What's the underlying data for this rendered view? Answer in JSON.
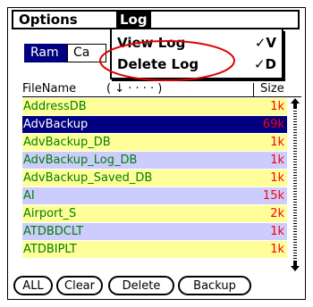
{
  "menubar": {
    "options_label": "Options",
    "log_label": "Log"
  },
  "log_menu": {
    "items": [
      {
        "label": "View Log",
        "shortcut": "✓V"
      },
      {
        "label": "Delete Log",
        "shortcut": "✓D"
      }
    ]
  },
  "toolbar": {
    "ram_label": "Ram",
    "card_label": "Ca"
  },
  "columns": {
    "filename": "FileName",
    "sort_hint": "( ↓ · · · · )",
    "size": "Size"
  },
  "files": [
    {
      "name": "AddressDB",
      "size": "1k",
      "style": "yellow"
    },
    {
      "name": "AdvBackup",
      "size": "69k",
      "style": "selected"
    },
    {
      "name": "AdvBackup_DB",
      "size": "1k",
      "style": "yellow"
    },
    {
      "name": "AdvBackup_Log_DB",
      "size": "1k",
      "style": "lav"
    },
    {
      "name": "AdvBackup_Saved_DB",
      "size": "1k",
      "style": "yellow"
    },
    {
      "name": "AI",
      "size": "15k",
      "style": "lav"
    },
    {
      "name": "Airport_S",
      "size": "2k",
      "style": "yellow"
    },
    {
      "name": "ATDBDCLT",
      "size": "1k",
      "style": "lav"
    },
    {
      "name": "ATDBIPLT",
      "size": "1k",
      "style": "yellow"
    }
  ],
  "buttons": {
    "all": "ALL",
    "clear": "Clear",
    "delete": "Delete",
    "backup": "Backup"
  },
  "colors": {
    "selected_row": "#000080",
    "filename_text": "#008000",
    "size_text": "#ff0000",
    "row_yellow": "#ffff99",
    "row_lavender": "#ccccff",
    "annotation": "#e00000"
  },
  "icons": {
    "scroll_up": "up-arrow-icon",
    "scroll_down": "down-arrow-icon"
  }
}
